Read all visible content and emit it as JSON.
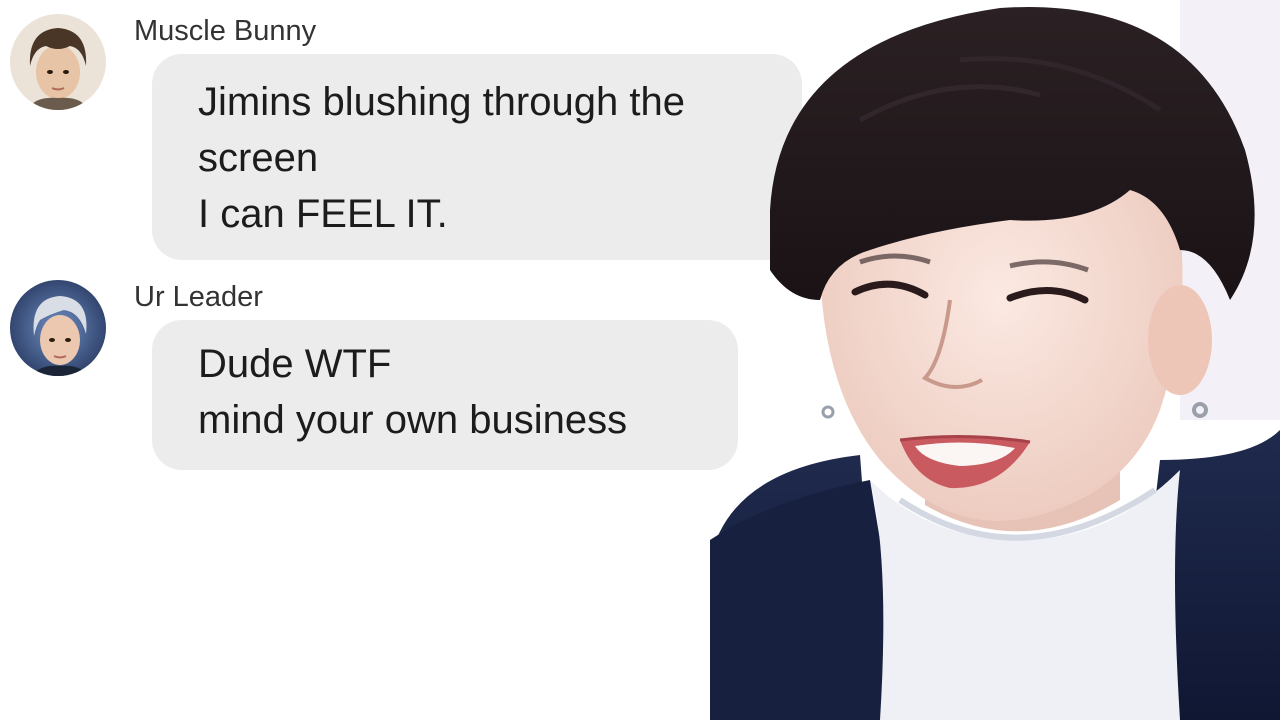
{
  "messages": [
    {
      "sender": "Muscle Bunny",
      "avatar_icon": "user-avatar-icon",
      "lines": [
        "Jimins blushing through the",
        "screen",
        "I can FEEL IT."
      ]
    },
    {
      "sender": "Ur Leader",
      "avatar_icon": "user-avatar-icon",
      "lines": [
        "Dude WTF",
        "mind your own business"
      ]
    }
  ],
  "colors": {
    "bubble": "#ececec",
    "text": "#1c1c1c",
    "sender": "#333333",
    "background": "#ffffff"
  }
}
